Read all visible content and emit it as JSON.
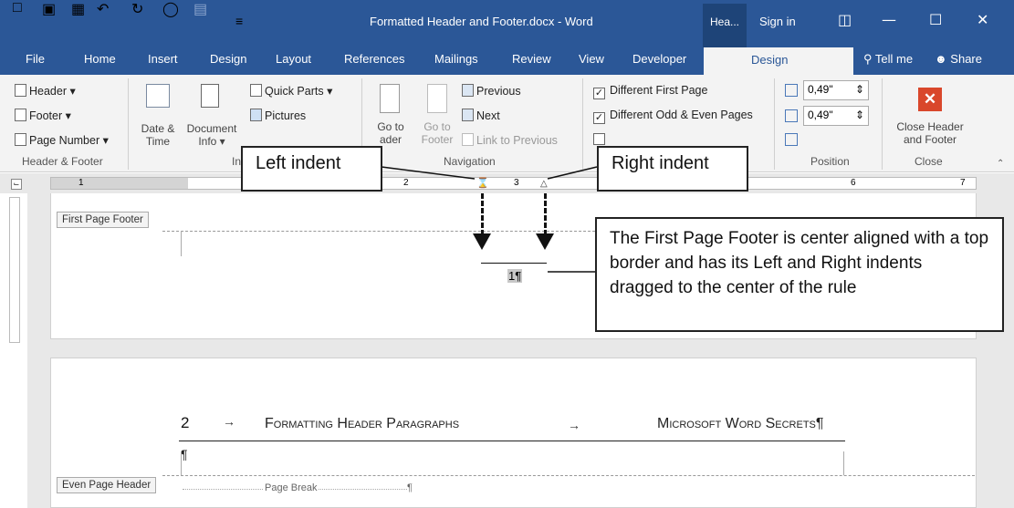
{
  "titlebar": {
    "doc_title": "Formatted Header and Footer.docx  -  Word",
    "context_tab": "Hea...",
    "sign_in": "Sign in"
  },
  "tabs": [
    "File",
    "Home",
    "Insert",
    "Design",
    "Layout",
    "References",
    "Mailings",
    "Review",
    "View",
    "Developer"
  ],
  "active_tab": "Design",
  "tell_me": "Tell me",
  "share": "Share",
  "ribbon": {
    "header": "Header",
    "footer": "Footer",
    "page_number": "Page Number",
    "group_header_footer": "Header & Footer",
    "date_time_1": "Date &",
    "date_time_2": "Time",
    "document_info_1": "Document",
    "document_info_2": "Info",
    "quick_parts": "Quick Parts",
    "pictures": "Pictures",
    "insert_group_partial": "In",
    "goto_header_1": "Go to",
    "goto_header_2": "ader",
    "goto_footer_1": "Go to",
    "goto_footer_2": "Footer",
    "previous": "Previous",
    "next": "Next",
    "link_to_previous": "Link to Previous",
    "group_navigation": "Navigation",
    "different_first_page": "Different First Page",
    "different_odd_even": "Different Odd & Even Pages",
    "pos_top": "0,49\"",
    "pos_bottom": "0,49\"",
    "group_position": "Position",
    "close_1": "Close Header",
    "close_2": "and Footer",
    "group_close": "Close"
  },
  "ruler": {
    "marks": [
      "1",
      "2",
      "3",
      "6",
      "7"
    ]
  },
  "page1": {
    "footer_tag": "First Page Footer",
    "page_num": "1¶"
  },
  "page2": {
    "num": "2",
    "left_text": "Formatting Header Paragraphs",
    "right_text": "Microsoft Word Secrets¶",
    "pilcrow": "¶",
    "header_tag": "Even Page Header",
    "page_break": "Page Break",
    "page_break_end": "¶"
  },
  "callouts": {
    "left_indent": "Left indent",
    "right_indent": "Right indent",
    "explain": "The First Page Footer is center aligned with a top border and has its Left and Right indents dragged to the center of the rule"
  },
  "colors": {
    "brand": "#2b5797",
    "close": "#d9472b"
  }
}
